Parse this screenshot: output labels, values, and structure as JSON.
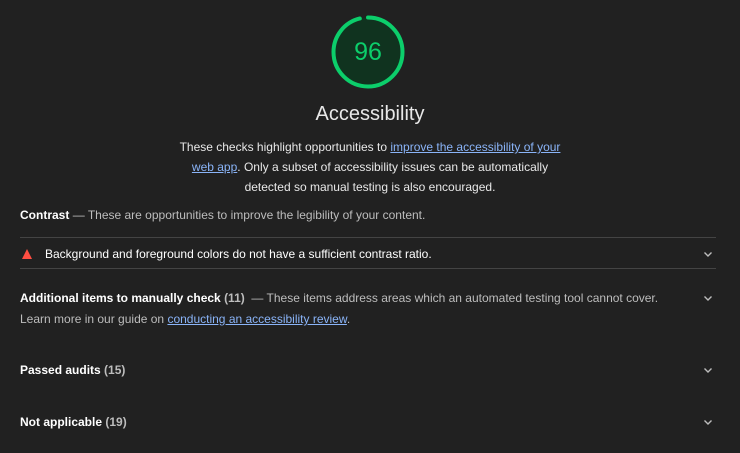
{
  "score": {
    "value": "96",
    "fraction": 0.96,
    "color": "#0cce6b",
    "track_color": "#10331f"
  },
  "category": {
    "title": "Accessibility",
    "desc_pre": "These checks highlight opportunities to ",
    "desc_link": "improve the accessibility of your web app",
    "desc_post": ". Only a subset of accessibility issues can be automatically detected so manual testing is also encouraged."
  },
  "contrast_group": {
    "title": "Contrast",
    "separator": "—",
    "description": "These are opportunities to improve the legibility of your content."
  },
  "audit": {
    "icon": "fail-triangle-icon",
    "title": "Background and foreground colors do not have a sufficient contrast ratio."
  },
  "manual": {
    "title": "Additional items to manually check",
    "count": "(11)",
    "separator": "—",
    "description": "These items address areas which an automated testing tool cannot cover.",
    "learn_pre": "Learn more in our guide on ",
    "learn_link": "conducting an accessibility review",
    "learn_post": "."
  },
  "passed": {
    "title": "Passed audits",
    "count": "(15)"
  },
  "not_applicable": {
    "title": "Not applicable",
    "count": "(19)"
  },
  "icons": {
    "chevron": "chevron-down-icon"
  }
}
